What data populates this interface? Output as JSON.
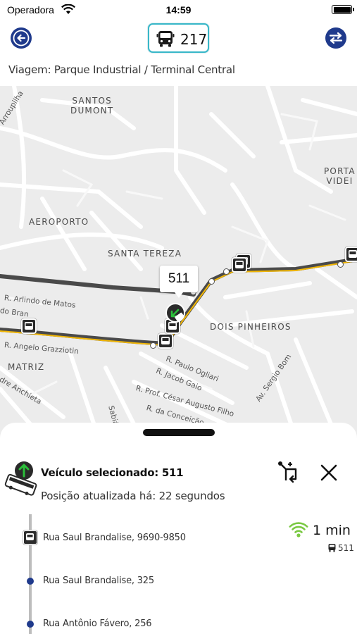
{
  "status_bar": {
    "carrier": "Operadora",
    "time": "14:59"
  },
  "header": {
    "route_number": "217",
    "trip_label": "Viagem: Parque Industrial / Terminal Central",
    "icons": [
      "back-arrow-icon",
      "bus-icon",
      "swap-direction-icon"
    ]
  },
  "map": {
    "neighborhoods": [
      {
        "name": "SANTOS DUMONT",
        "lines": [
          "SANTOS",
          "DUMONT"
        ]
      },
      {
        "name": "AEROPORTO",
        "lines": [
          "AEROPORTO"
        ]
      },
      {
        "name": "SANTA TEREZA",
        "lines": [
          "SANTA TEREZA"
        ]
      },
      {
        "name": "DOIS PINHEIROS",
        "lines": [
          "DOIS PINHEIROS"
        ]
      },
      {
        "name": "MATRIZ",
        "lines": [
          "MATRIZ"
        ]
      },
      {
        "name": "PORTAL VIDEIRA",
        "lines": [
          "PORTA",
          "VIDEI"
        ]
      }
    ],
    "streets": [
      "R. Arlindo de Matos",
      "R. Angelo Grazziotin",
      "R. Paulo Ogliari",
      "R. Jacob Gaio",
      "R. Prof. César Augusto Filho",
      "R. da Conceição",
      "Av. Sergio Bom",
      "Sabiá",
      "dre Anchieta",
      "do Bran",
      "Arroupilha"
    ],
    "vehicle_callout": "511",
    "colors": {
      "route_line": "#4a4a4a",
      "route_highlight": "#f2b705",
      "stop_marker": "#2a2a2a"
    }
  },
  "sheet": {
    "vehicle_title": "Veículo selecionado: 511",
    "updated_text": "Posição atualizada há: 22 segundos",
    "stops": [
      {
        "name": "Rua Saul Brandalise, 9690-9850",
        "type": "bus-stop"
      },
      {
        "name": "Rua Saul Brandalise, 325",
        "type": "point"
      },
      {
        "name": "Rua Antônio Fávero, 256",
        "type": "point"
      }
    ],
    "eta": {
      "time": "1 min",
      "vehicle": "511",
      "signal_color": "#7ac943"
    },
    "colors": {
      "accent": "#1f3a8c",
      "direction_arrow": "#2bbf3a"
    }
  }
}
